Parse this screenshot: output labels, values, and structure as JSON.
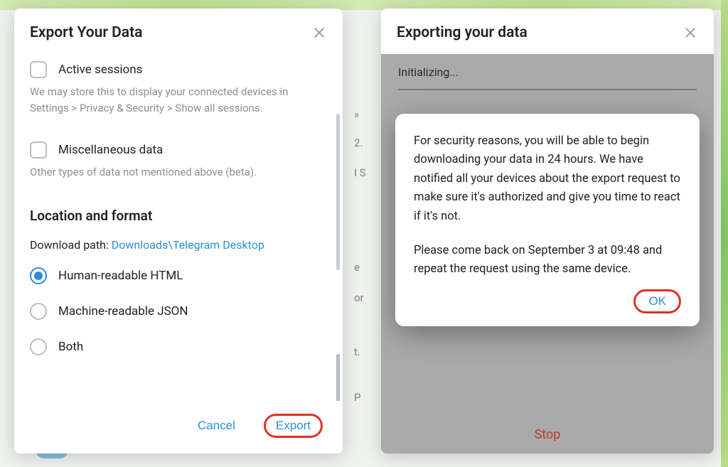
{
  "left_dialog": {
    "title": "Export Your Data",
    "active_sessions": {
      "label": "Active sessions",
      "hint": "We may store this to display your connected devices in Settings > Privacy & Security > Show all sessions."
    },
    "misc_data": {
      "label": "Miscellaneous data",
      "hint": "Other types of data not mentioned above (beta)."
    },
    "location_section": "Location and format",
    "download_path_label": "Download path: ",
    "download_path_value": "Downloads\\Telegram Desktop",
    "formats": {
      "html": "Human-readable HTML",
      "json": "Machine-readable JSON",
      "both": "Both",
      "selected": "html"
    },
    "buttons": {
      "cancel": "Cancel",
      "export": "Export"
    }
  },
  "right_dialog": {
    "title": "Exporting your data",
    "status": "Initializing...",
    "popup": {
      "p1": "For security reasons, you will be able to begin downloading your data in 24 hours. We have notified all your devices about the export request to make sure it's authorized and give you time to react if it's not.",
      "p2": "Please come back on September 3 at 09:48 and repeat the request using the same device.",
      "ok": "OK"
    },
    "stop": "Stop"
  },
  "mid_hints": [
    "»",
    "2.",
    "I S",
    "e",
    "or",
    "t.",
    "P"
  ]
}
